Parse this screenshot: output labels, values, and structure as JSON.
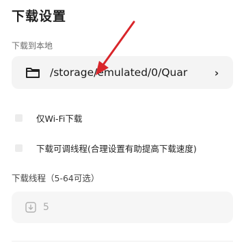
{
  "page": {
    "title": "下载设置"
  },
  "download_location": {
    "label": "下载到本地",
    "path": "/storage/emulated/0/Quar",
    "chevron": "›",
    "icon": "folder-icon"
  },
  "options": {
    "wifi_only": {
      "label": "仅Wi-Fi下载",
      "checked": false
    },
    "adjustable_threads": {
      "label": "下载可调线程(合理设置有助提高下载速度)",
      "checked": false
    }
  },
  "threads": {
    "label": "下载线程（5-64可选）",
    "value": "5",
    "icon": "download-icon"
  },
  "annotation": {
    "arrow_color": "#d9252a"
  }
}
